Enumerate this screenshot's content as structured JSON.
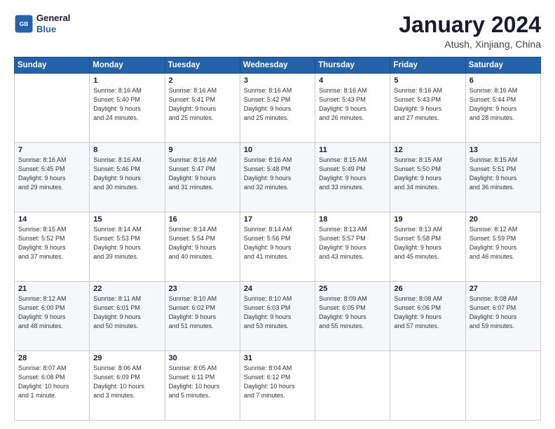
{
  "header": {
    "logo_line1": "General",
    "logo_line2": "Blue",
    "title": "January 2024",
    "subtitle": "Atush, Xinjiang, China"
  },
  "days_of_week": [
    "Sunday",
    "Monday",
    "Tuesday",
    "Wednesday",
    "Thursday",
    "Friday",
    "Saturday"
  ],
  "weeks": [
    [
      {
        "day": "",
        "info": ""
      },
      {
        "day": "1",
        "info": "Sunrise: 8:16 AM\nSunset: 5:40 PM\nDaylight: 9 hours\nand 24 minutes."
      },
      {
        "day": "2",
        "info": "Sunrise: 8:16 AM\nSunset: 5:41 PM\nDaylight: 9 hours\nand 25 minutes."
      },
      {
        "day": "3",
        "info": "Sunrise: 8:16 AM\nSunset: 5:42 PM\nDaylight: 9 hours\nand 25 minutes."
      },
      {
        "day": "4",
        "info": "Sunrise: 8:16 AM\nSunset: 5:43 PM\nDaylight: 9 hours\nand 26 minutes."
      },
      {
        "day": "5",
        "info": "Sunrise: 8:16 AM\nSunset: 5:43 PM\nDaylight: 9 hours\nand 27 minutes."
      },
      {
        "day": "6",
        "info": "Sunrise: 8:16 AM\nSunset: 5:44 PM\nDaylight: 9 hours\nand 28 minutes."
      }
    ],
    [
      {
        "day": "7",
        "info": ""
      },
      {
        "day": "8",
        "info": "Sunrise: 8:16 AM\nSunset: 5:46 PM\nDaylight: 9 hours\nand 30 minutes."
      },
      {
        "day": "9",
        "info": "Sunrise: 8:16 AM\nSunset: 5:47 PM\nDaylight: 9 hours\nand 31 minutes."
      },
      {
        "day": "10",
        "info": "Sunrise: 8:16 AM\nSunset: 5:48 PM\nDaylight: 9 hours\nand 32 minutes."
      },
      {
        "day": "11",
        "info": "Sunrise: 8:15 AM\nSunset: 5:49 PM\nDaylight: 9 hours\nand 33 minutes."
      },
      {
        "day": "12",
        "info": "Sunrise: 8:15 AM\nSunset: 5:50 PM\nDaylight: 9 hours\nand 34 minutes."
      },
      {
        "day": "13",
        "info": "Sunrise: 8:15 AM\nSunset: 5:51 PM\nDaylight: 9 hours\nand 36 minutes."
      }
    ],
    [
      {
        "day": "14",
        "info": ""
      },
      {
        "day": "15",
        "info": "Sunrise: 8:14 AM\nSunset: 5:53 PM\nDaylight: 9 hours\nand 39 minutes."
      },
      {
        "day": "16",
        "info": "Sunrise: 8:14 AM\nSunset: 5:54 PM\nDaylight: 9 hours\nand 40 minutes."
      },
      {
        "day": "17",
        "info": "Sunrise: 8:14 AM\nSunset: 5:56 PM\nDaylight: 9 hours\nand 41 minutes."
      },
      {
        "day": "18",
        "info": "Sunrise: 8:13 AM\nSunset: 5:57 PM\nDaylight: 9 hours\nand 43 minutes."
      },
      {
        "day": "19",
        "info": "Sunrise: 8:13 AM\nSunset: 5:58 PM\nDaylight: 9 hours\nand 45 minutes."
      },
      {
        "day": "20",
        "info": "Sunrise: 8:12 AM\nSunset: 5:59 PM\nDaylight: 9 hours\nand 46 minutes."
      }
    ],
    [
      {
        "day": "21",
        "info": ""
      },
      {
        "day": "22",
        "info": "Sunrise: 8:11 AM\nSunset: 6:01 PM\nDaylight: 9 hours\nand 50 minutes."
      },
      {
        "day": "23",
        "info": "Sunrise: 8:10 AM\nSunset: 6:02 PM\nDaylight: 9 hours\nand 51 minutes."
      },
      {
        "day": "24",
        "info": "Sunrise: 8:10 AM\nSunset: 6:03 PM\nDaylight: 9 hours\nand 53 minutes."
      },
      {
        "day": "25",
        "info": "Sunrise: 8:09 AM\nSunset: 6:05 PM\nDaylight: 9 hours\nand 55 minutes."
      },
      {
        "day": "26",
        "info": "Sunrise: 8:08 AM\nSunset: 6:06 PM\nDaylight: 9 hours\nand 57 minutes."
      },
      {
        "day": "27",
        "info": "Sunrise: 8:08 AM\nSunset: 6:07 PM\nDaylight: 9 hours\nand 59 minutes."
      }
    ],
    [
      {
        "day": "28",
        "info": "Sunrise: 8:07 AM\nSunset: 6:08 PM\nDaylight: 10 hours\nand 1 minute."
      },
      {
        "day": "29",
        "info": "Sunrise: 8:06 AM\nSunset: 6:09 PM\nDaylight: 10 hours\nand 3 minutes."
      },
      {
        "day": "30",
        "info": "Sunrise: 8:05 AM\nSunset: 6:11 PM\nDaylight: 10 hours\nand 5 minutes."
      },
      {
        "day": "31",
        "info": "Sunrise: 8:04 AM\nSunset: 6:12 PM\nDaylight: 10 hours\nand 7 minutes."
      },
      {
        "day": "",
        "info": ""
      },
      {
        "day": "",
        "info": ""
      },
      {
        "day": "",
        "info": ""
      }
    ]
  ],
  "week7_sunday_info": "Sunrise: 8:16 AM\nSunset: 5:45 PM\nDaylight: 9 hours\nand 29 minutes.",
  "week14_sunday_info": "Sunrise: 8:15 AM\nSunset: 5:52 PM\nDaylight: 9 hours\nand 37 minutes.",
  "week21_sunday_info": "Sunrise: 8:12 AM\nSunset: 6:00 PM\nDaylight: 9 hours\nand 48 minutes."
}
